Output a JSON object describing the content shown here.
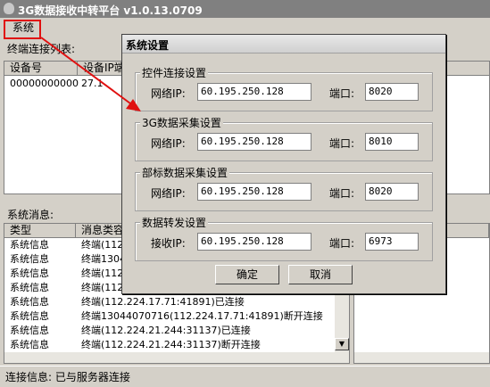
{
  "window": {
    "title": "3G数据接收中转平台 v1.0.13.0709"
  },
  "menu": {
    "system": "系统"
  },
  "terminals": {
    "label": "终端连接列表:",
    "columns": [
      "设备号",
      "设备IP端口"
    ],
    "rows": [
      {
        "device": "00000000000",
        "ip": "27.1"
      }
    ]
  },
  "messages": {
    "label": "系统消息:",
    "columns": [
      "类型",
      "消息类容"
    ],
    "rows": [
      {
        "type": "系统信息",
        "text": "终端(112"
      },
      {
        "type": "系统信息",
        "text": "终端1304"
      },
      {
        "type": "系统信息",
        "text": "终端(112"
      },
      {
        "type": "系统信息",
        "text": "终端(112"
      },
      {
        "type": "系统信息",
        "text": "终端(112.224.17.71:41891)已连接"
      },
      {
        "type": "系统信息",
        "text": "终端13044070716(112.224.17.71:41891)断开连接"
      },
      {
        "type": "系统信息",
        "text": "终端(112.224.21.244:31137)已连接"
      },
      {
        "type": "系统信息",
        "text": "终端(112.224.21.244:31137)断开连接"
      }
    ]
  },
  "status": {
    "text": "连接信息: 已与服务器连接"
  },
  "dialog": {
    "title": "系统设置",
    "groups": [
      {
        "legend": "控件连接设置",
        "ip_label": "网络IP:",
        "ip": "60.195.250.128",
        "port_label": "端口:",
        "port": "8020"
      },
      {
        "legend": "3G数据采集设置",
        "ip_label": "网络IP:",
        "ip": "60.195.250.128",
        "port_label": "端口:",
        "port": "8010"
      },
      {
        "legend": "部标数据采集设置",
        "ip_label": "网络IP:",
        "ip": "60.195.250.128",
        "port_label": "端口:",
        "port": "8020"
      },
      {
        "legend": "数据转发设置",
        "ip_label": "接收IP:",
        "ip": "60.195.250.128",
        "port_label": "端口:",
        "port": "6973"
      }
    ],
    "ok": "确定",
    "cancel": "取消"
  },
  "colors": {
    "annotation": "#e01010"
  }
}
